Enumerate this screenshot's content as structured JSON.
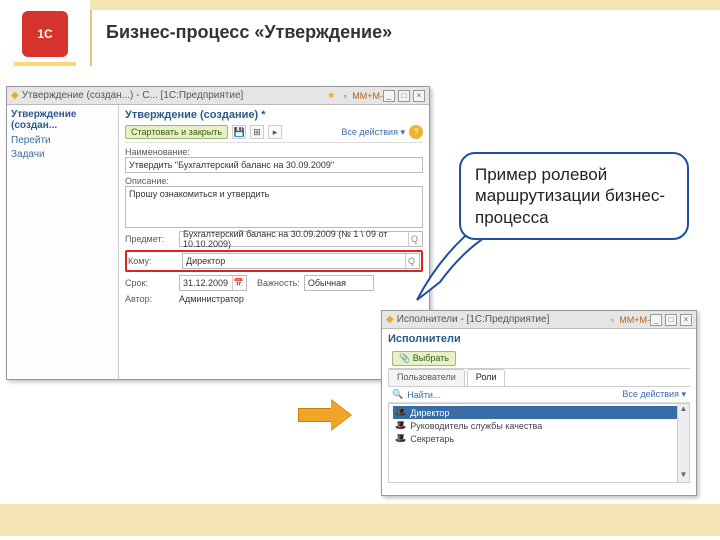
{
  "slide": {
    "title": "Бизнес-процесс «Утверждение»",
    "logo_text": "1С"
  },
  "callout": {
    "text": "Пример ролевой маршрутизации бизнес-процесса"
  },
  "win1": {
    "titlebar": "Утверждение (создан...) - С... [1С:Предприятие]",
    "tb_marks": [
      "M",
      "M+",
      "M-"
    ],
    "nav_title": "Утверждение (создан...",
    "nav_links": [
      "Перейти",
      "Задачи"
    ],
    "form_title": "Утверждение (создание) *",
    "btn_start": "Стартовать и закрыть",
    "all_actions": "Все действия",
    "labels": {
      "name": "Наименование:",
      "desc": "Описание:",
      "subject": "Предмет:",
      "to": "Кому:",
      "deadline": "Срок:",
      "importance": "Важность:",
      "author": "Автор:"
    },
    "values": {
      "name": "Утвердить \"Бухгалтерский баланс на 30.09.2009\"",
      "desc": "Прошу ознакомиться и утвердить",
      "subject": "Бухгалтерский баланс на 30.09.2009 (№ 1 \\ 09 от 10.10.2009)",
      "to": "Директор",
      "deadline": "31.12.2009",
      "importance": "Обычная",
      "author": "Администратор"
    }
  },
  "win2": {
    "titlebar": "Исполнители - [1С:Предприятие]",
    "tb_marks": [
      "M",
      "M+",
      "M-"
    ],
    "heading": "Исполнители",
    "select_btn": "Выбрать",
    "tabs": [
      "Пользователи",
      "Роли"
    ],
    "find_label": "Найти...",
    "all_actions": "Все действия",
    "rows": [
      "Директор",
      "Руководитель службы качества",
      "Секретарь"
    ]
  }
}
